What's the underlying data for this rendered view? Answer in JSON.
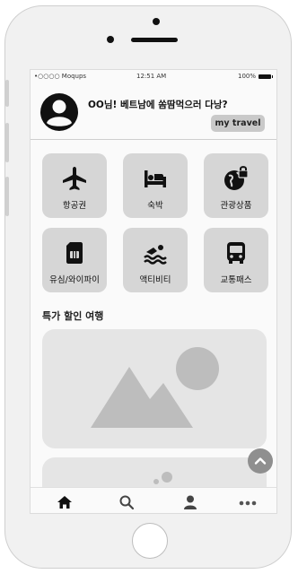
{
  "status_bar": {
    "carrier": "•○○○○ Moqups",
    "time": "12:51 AM",
    "battery": "100%"
  },
  "profile": {
    "greeting": "OO님! 베트남에 쏨땀먹으러 다낭?",
    "button_label": "my travel"
  },
  "categories": [
    {
      "label": "항공권",
      "icon": "airplane-icon"
    },
    {
      "label": "숙박",
      "icon": "bed-icon"
    },
    {
      "label": "관광상품",
      "icon": "globe-lock-icon"
    },
    {
      "label": "유심/와이파이",
      "icon": "sim-card-icon"
    },
    {
      "label": "액티비티",
      "icon": "swimming-icon"
    },
    {
      "label": "교통패스",
      "icon": "bus-icon"
    }
  ],
  "section": {
    "title": "특가 할인 여행"
  },
  "tabs": [
    {
      "name": "home",
      "icon": "home-icon"
    },
    {
      "name": "search",
      "icon": "search-icon"
    },
    {
      "name": "profile",
      "icon": "user-icon"
    },
    {
      "name": "more",
      "icon": "more-icon"
    }
  ],
  "colors": {
    "tile": "#d6d6d6",
    "card": "#e5e5e5",
    "placeholder": "#bdbdbd",
    "fab": "#8f8f8f"
  }
}
